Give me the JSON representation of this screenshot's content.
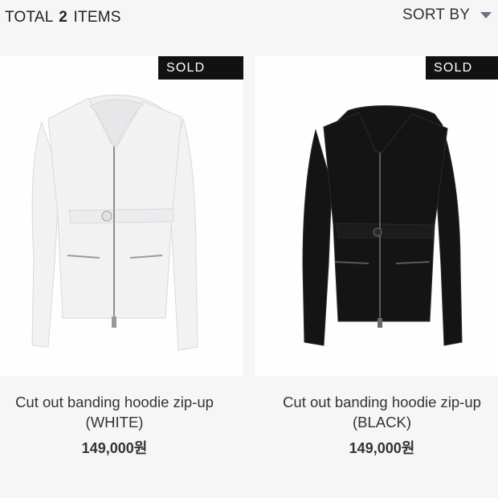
{
  "header": {
    "total_prefix": "TOTAL",
    "total_count": "2",
    "total_suffix": "ITEMS",
    "sort_label": "SORT BY"
  },
  "products": [
    {
      "badge": "SOLD OUT",
      "name_line1": "Cut out banding hoodie zip-up",
      "name_line2": "(WHITE)",
      "price": "149,000원",
      "color": "#ffffff"
    },
    {
      "badge": "SOLD OUT",
      "name_line1": "Cut out banding hoodie zip-up",
      "name_line2": "(BLACK)",
      "price": "149,000원",
      "color": "#111111"
    }
  ]
}
